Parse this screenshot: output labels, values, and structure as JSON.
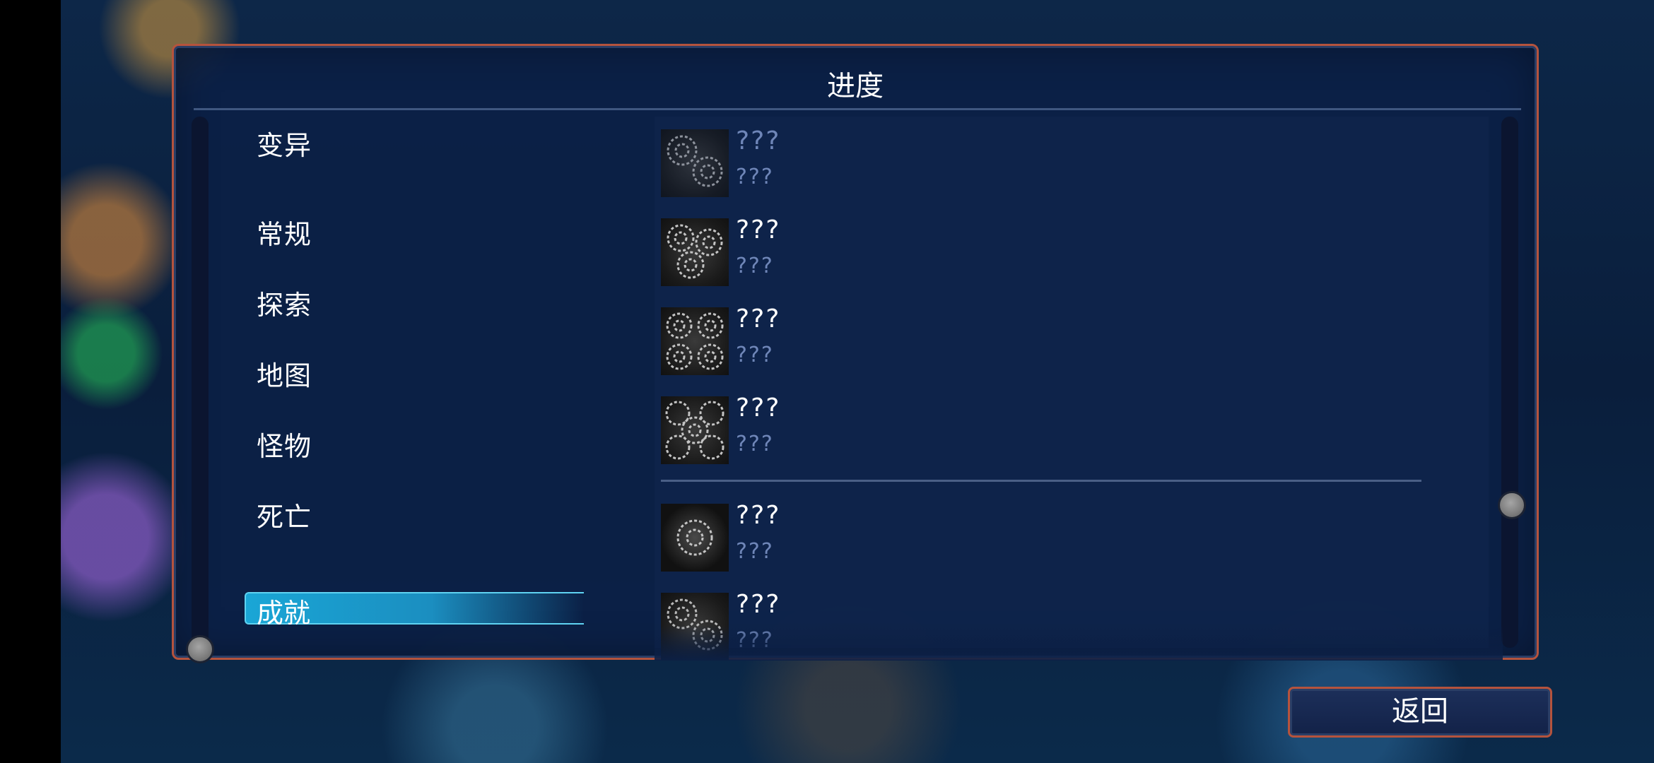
{
  "panel": {
    "title": "进度"
  },
  "categories": [
    {
      "label": "变异",
      "selected": false
    },
    {
      "label": "常规",
      "selected": false
    },
    {
      "label": "探索",
      "selected": false
    },
    {
      "label": "地图",
      "selected": false
    },
    {
      "label": "怪物",
      "selected": false
    },
    {
      "label": "死亡",
      "selected": false
    },
    {
      "label": "成就",
      "selected": true
    }
  ],
  "achievements": [
    {
      "title": "???",
      "description": "???",
      "icon": "two-gears-icon",
      "faded": true
    },
    {
      "title": "???",
      "description": "???",
      "icon": "three-gears-icon",
      "faded": false
    },
    {
      "title": "???",
      "description": "???",
      "icon": "four-gears-icon",
      "faded": false
    },
    {
      "title": "???",
      "description": "???",
      "icon": "five-gears-icon",
      "faded": false
    },
    {
      "title": "???",
      "description": "???",
      "icon": "single-gear-icon",
      "faded": false
    },
    {
      "title": "???",
      "description": "???",
      "icon": "two-gears-icon",
      "faded": false
    }
  ],
  "buttons": {
    "back_label": "返回"
  },
  "colors": {
    "border": "#b5533d",
    "selected": "#1aa6d6",
    "locked_text": "#6f86b8"
  }
}
